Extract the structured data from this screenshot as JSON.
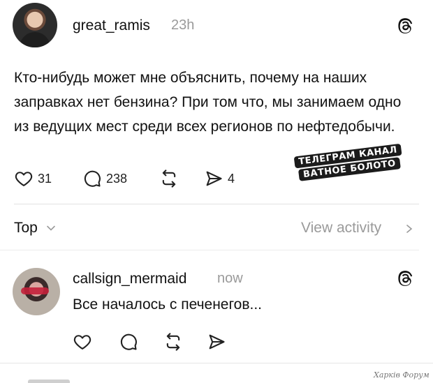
{
  "post": {
    "username": "great_ramis",
    "time": "23h",
    "text": "Кто-нибудь может мне объяснить, почему на наших заправках нет бензина? При том что, мы занимаем одно из ведущих мест среди всех регионов по нефтедобычи.",
    "likes": "31",
    "replies": "238",
    "shares": "4"
  },
  "watermark": {
    "line1": "ТЕЛЕГРАМ КАНАЛ",
    "line2": "ВАТНОЕ БОЛОТО"
  },
  "sort": {
    "label": "Top",
    "view_activity": "View activity"
  },
  "reply": {
    "username": "callsign_mermaid",
    "time": "now",
    "text": "Все началось с печенегов..."
  },
  "footer": {
    "forum_mark": "Харків Форум"
  },
  "icons": {
    "threads": "threads-logo-icon",
    "like": "heart-icon",
    "reply": "comment-bubble-icon",
    "repost": "repost-arrows-icon",
    "share": "send-arrow-icon"
  }
}
